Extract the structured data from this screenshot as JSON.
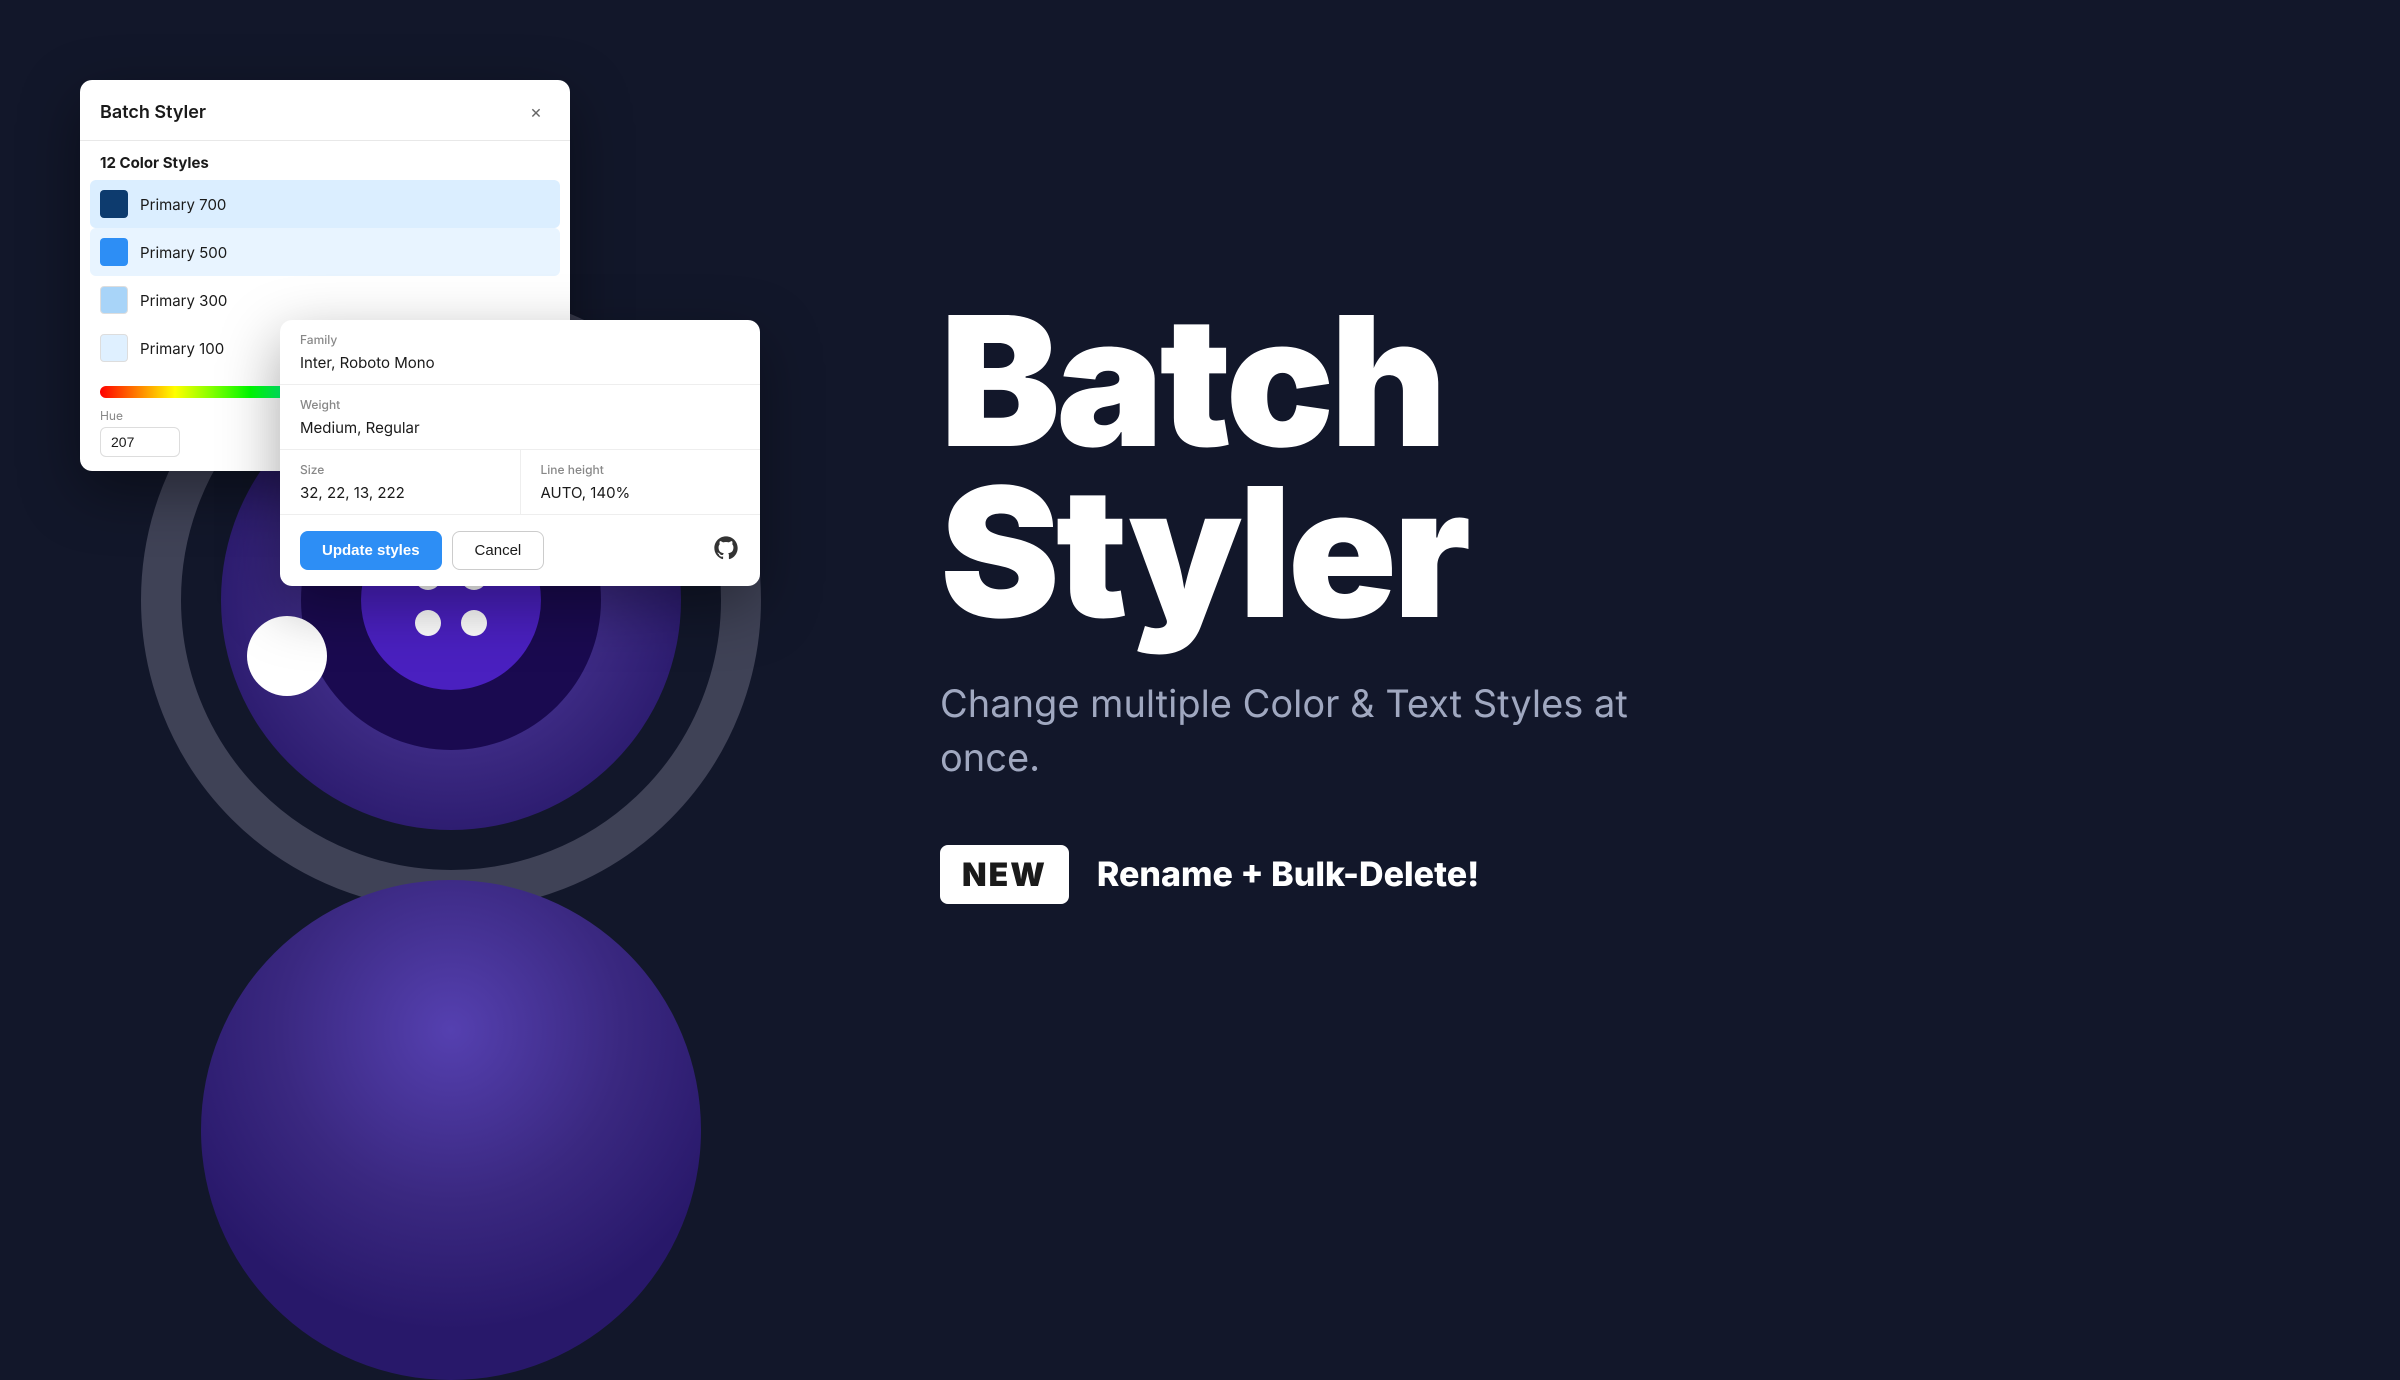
{
  "app": {
    "background": "#12172a"
  },
  "window": {
    "title": "Batch Styler",
    "close_icon": "×",
    "styles_count": "12 Color Styles",
    "color_items": [
      {
        "name": "Primary 700",
        "color": "#0d3b6e",
        "selected": "primary"
      },
      {
        "name": "Primary 500",
        "color": "#2d8ef5",
        "selected": "secondary"
      },
      {
        "name": "Primary 300",
        "color": "#a8d4f8",
        "selected": "none"
      },
      {
        "name": "Primary 100",
        "color": "#dff0ff",
        "selected": "none"
      }
    ],
    "hue_label": "Hue",
    "hue_value": "207"
  },
  "typography_panel": {
    "family_label": "Family",
    "family_value": "Inter, Roboto Mono",
    "weight_label": "Weight",
    "weight_value": "Medium, Regular",
    "size_label": "Size",
    "size_value": "32, 22, 13, 222",
    "line_height_label": "Line height",
    "line_height_value": "AUTO, 140%",
    "update_button": "Update styles",
    "cancel_button": "Cancel"
  },
  "hero": {
    "title_line1": "Batch",
    "title_line2": "Styler",
    "subtitle": "Change multiple Color & Text Styles at once.",
    "new_badge": "NEW",
    "new_feature": "Rename + Bulk-Delete!"
  }
}
